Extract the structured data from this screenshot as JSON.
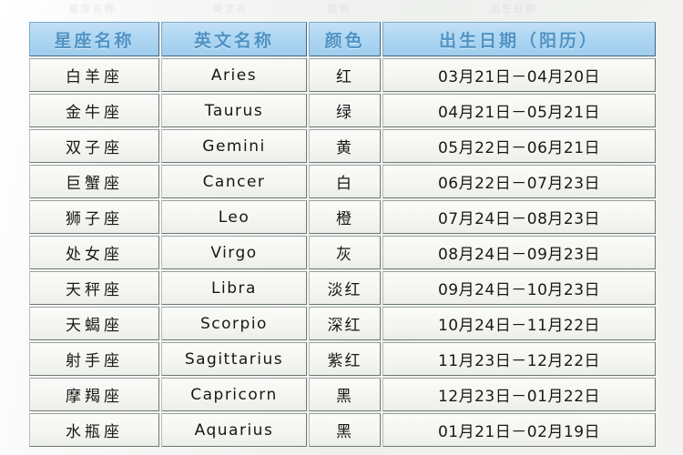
{
  "ghost_row": {
    "note": "faint clipped row remnant above table",
    "cells": [
      "星座名称",
      "英文名",
      "颜色",
      "出生日期"
    ]
  },
  "table": {
    "headers": [
      "星座名称",
      "英文名称",
      "颜色",
      "出生日期（阳历）"
    ],
    "header_bg": "#aed6f2",
    "header_text_color": "#4f93c4",
    "cell_bg": "#f4f5f1",
    "border_color": "#6f7873",
    "rows": [
      {
        "name": "白羊座",
        "english": "Aries",
        "color": "红",
        "date": "03月21日－04月20日"
      },
      {
        "name": "金牛座",
        "english": "Taurus",
        "color": "绿",
        "date": "04月21日－05月21日"
      },
      {
        "name": "双子座",
        "english": "Gemini",
        "color": "黄",
        "date": "05月22日－06月21日"
      },
      {
        "name": "巨蟹座",
        "english": "Cancer",
        "color": "白",
        "date": "06月22日－07月23日"
      },
      {
        "name": "狮子座",
        "english": "Leo",
        "color": "橙",
        "date": "07月24日－08月23日"
      },
      {
        "name": "处女座",
        "english": "Virgo",
        "color": "灰",
        "date": "08月24日－09月23日"
      },
      {
        "name": "天秤座",
        "english": "Libra",
        "color": "淡红",
        "date": "09月24日－10月23日"
      },
      {
        "name": "天蝎座",
        "english": "Scorpio",
        "color": "深红",
        "date": "10月24日－11月22日"
      },
      {
        "name": "射手座",
        "english": "Sagittarius",
        "color": "紫红",
        "date": "11月23日－12月22日"
      },
      {
        "name": "摩羯座",
        "english": "Capricorn",
        "color": "黑",
        "date": "12月23日－01月22日"
      },
      {
        "name": "水瓶座",
        "english": "Aquarius",
        "color": "黑",
        "date": "01月21日－02月19日"
      }
    ]
  }
}
